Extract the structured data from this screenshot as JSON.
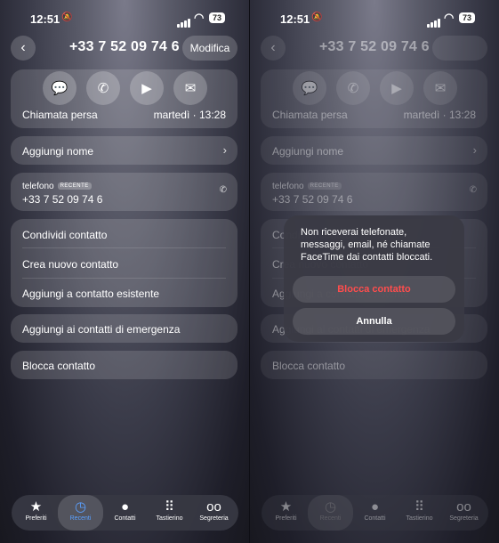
{
  "status": {
    "time": "12:51",
    "battery": "73"
  },
  "header": {
    "back_icon": "chevron-left-icon",
    "number": "+33 7 52 09 74 6",
    "edit_label": "Modifica"
  },
  "actions": [
    "message-icon",
    "phone-icon",
    "video-icon",
    "mail-icon"
  ],
  "call": {
    "label": "Chiamata persa",
    "when": "martedì · 13:28"
  },
  "add_name": "Aggiungi nome",
  "phone": {
    "label": "telefono",
    "badge": "RECENTE",
    "number": "+33 7 52 09 74 6"
  },
  "menu": [
    "Condividi contatto",
    "Crea nuovo contatto",
    "Aggiungi a contatto esistente"
  ],
  "emergency": "Aggiungi ai contatti di emergenza",
  "block": "Blocca contatto",
  "tabs": [
    {
      "label": "Preferiti",
      "icon": "star-icon"
    },
    {
      "label": "Recenti",
      "icon": "clock-icon"
    },
    {
      "label": "Contatti",
      "icon": "person-icon"
    },
    {
      "label": "Tastierino",
      "icon": "keypad-icon"
    },
    {
      "label": "Segreteria",
      "icon": "voicemail-icon"
    }
  ],
  "dialog": {
    "message": "Non riceverai telefonate, messaggi, email, né chiamate FaceTime dai contatti bloccati.",
    "confirm": "Blocca contatto",
    "cancel": "Annulla"
  },
  "colors": {
    "accent": "#5aa0ff",
    "danger": "#ff4d4d"
  }
}
